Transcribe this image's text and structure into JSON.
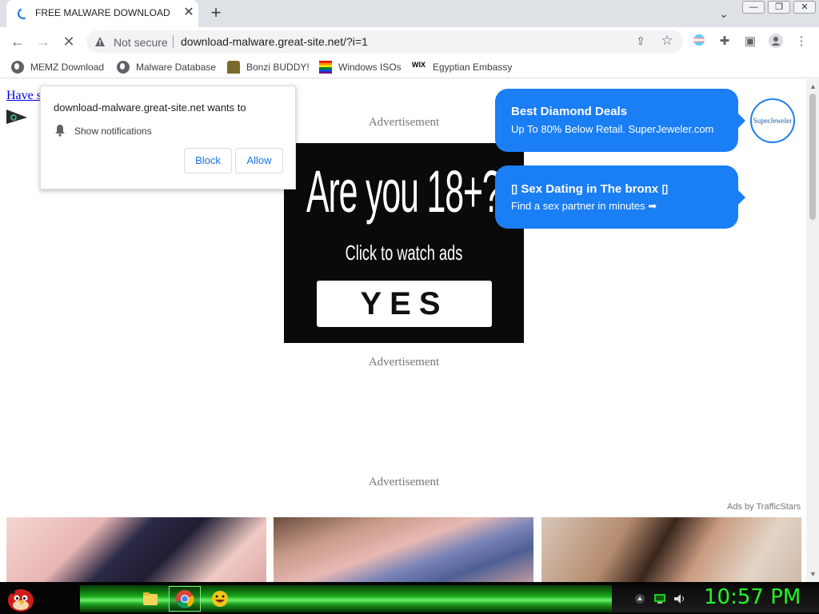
{
  "tab": {
    "title": "FREE MALWARE DOWNLOAD",
    "close": "✕",
    "new_tab": "+"
  },
  "window_controls": {
    "minimize": "—",
    "maximize": "❐",
    "close": "✕"
  },
  "omnibox": {
    "security_label": "Not secure",
    "url": "download-malware.great-site.net/?i=1"
  },
  "bookmarks": [
    {
      "label": "MEMZ Download",
      "icon": "globe-icon"
    },
    {
      "label": "Malware Database",
      "icon": "globe-icon"
    },
    {
      "label": "Bonzi BUDDY!",
      "icon": "bonzi-icon"
    },
    {
      "label": "Windows ISOs",
      "icon": "rainbow-flag-icon"
    },
    {
      "label": "Egyptian Embassy",
      "icon": "wix-icon"
    }
  ],
  "page": {
    "link_text": "Have s...",
    "ad_label": "Advertisement",
    "ad_banner": {
      "headline": "Are you 18+?",
      "subtext": "Click to watch ads",
      "button": "YES"
    },
    "promo1": {
      "title": "Best Diamond Deals",
      "text": "Up To 80% Below Retail. SuperJeweler.com",
      "logo": "SuperJeweler"
    },
    "promo2": {
      "title": "▯ Sex Dating in The bronx ▯",
      "text": "Find a sex partner in minutes ➡"
    },
    "ads_by": "Ads by TrafficStars"
  },
  "notification": {
    "title": "download-malware.great-site.net wants to",
    "text": "Show notifications",
    "block": "Block",
    "allow": "Allow"
  },
  "taskbar": {
    "clock": "10:57 PM"
  },
  "colors": {
    "accent": "#1a73e8",
    "bubble": "#1a7ef5",
    "clock": "#24f524"
  }
}
